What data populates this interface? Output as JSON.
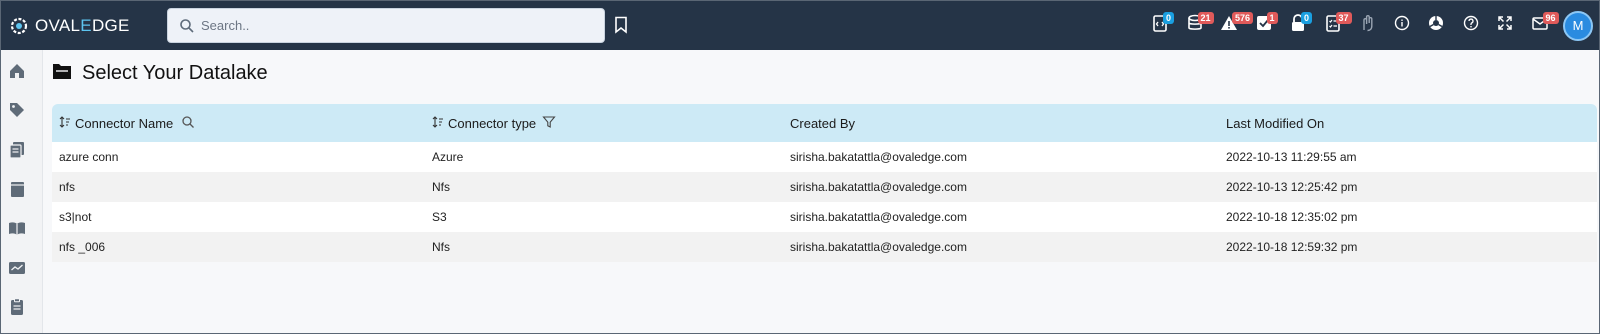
{
  "app": {
    "logo_text_1": "OVAL",
    "logo_text_2": "E",
    "logo_text_3": "DGE"
  },
  "search": {
    "placeholder": "Search.."
  },
  "toolbar": {
    "badges": {
      "queries": "0",
      "data_catalog": "21",
      "alerts": "576",
      "tasks": "1",
      "access": "0",
      "checklist": "37",
      "messages": "96"
    },
    "avatar_initial": "M"
  },
  "page": {
    "title": "Select Your Datalake"
  },
  "table": {
    "headers": {
      "connector_name": "Connector Name",
      "connector_type": "Connector type",
      "created_by": "Created By",
      "last_modified": "Last Modified On"
    },
    "rows": [
      {
        "name": "azure conn",
        "type": "Azure",
        "created_by": "sirisha.bakatattla@ovaledge.com",
        "modified": "2022-10-13 11:29:55 am"
      },
      {
        "name": "nfs",
        "type": "Nfs",
        "created_by": "sirisha.bakatattla@ovaledge.com",
        "modified": "2022-10-13 12:25:42 pm"
      },
      {
        "name": "s3|not",
        "type": "S3",
        "created_by": "sirisha.bakatattla@ovaledge.com",
        "modified": "2022-10-18 12:35:02 pm"
      },
      {
        "name": "nfs _006",
        "type": "Nfs",
        "created_by": "sirisha.bakatattla@ovaledge.com",
        "modified": "2022-10-18 12:59:32 pm"
      }
    ]
  }
}
